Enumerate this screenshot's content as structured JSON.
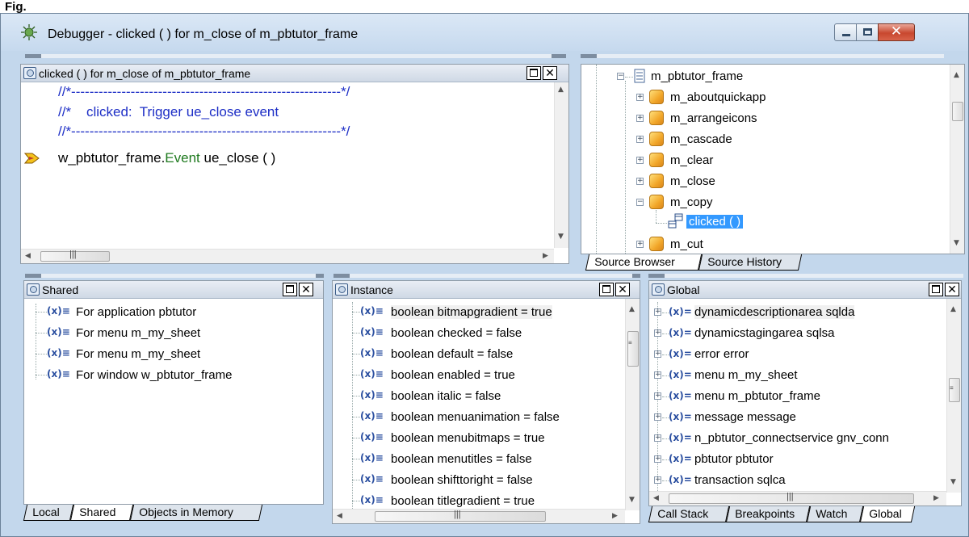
{
  "page_label": "Fig.",
  "window": {
    "title": "Debugger - clicked ( ) for m_close of m_pbtutor_frame",
    "title_icon": "bug-icon"
  },
  "source_pane": {
    "title": "clicked ( ) for m_close of m_pbtutor_frame",
    "lines": [
      "//*-----------------------------------------------------------*/",
      "//*    clicked:  Trigger ue_close event",
      "//*-----------------------------------------------------------*/"
    ],
    "current_line": {
      "object": "w_pbtutor_frame.",
      "keyword": "Event",
      "rest": " ue_close ( )"
    }
  },
  "browser_pane": {
    "root": "m_pbtutor_frame",
    "items": [
      "m_aboutquickapp",
      "m_arrangeicons",
      "m_cascade",
      "m_clear",
      "m_close",
      "m_copy",
      "clicked ( )",
      "m_cut"
    ],
    "tabs": [
      "Source Browser",
      "Source History"
    ]
  },
  "shared_pane": {
    "title": "Shared",
    "items": [
      "For application pbtutor",
      "For menu m_my_sheet",
      "For menu m_my_sheet",
      "For window w_pbtutor_frame"
    ],
    "tabs": [
      "Local",
      "Shared",
      "Objects in Memory"
    ]
  },
  "instance_pane": {
    "title": "Instance",
    "items": [
      "boolean bitmapgradient = true",
      "boolean checked = false",
      "boolean default = false",
      "boolean enabled = true",
      "boolean italic = false",
      "boolean menuanimation = false",
      "boolean menubitmaps = true",
      "boolean menutitles = false",
      "boolean shifttoright = false",
      "boolean titlegradient = true"
    ]
  },
  "global_pane": {
    "title": "Global",
    "items": [
      "dynamicdescriptionarea sqlda",
      "dynamicstagingarea sqlsa",
      "error error",
      "menu m_my_sheet",
      "menu m_pbtutor_frame",
      "message message",
      "n_pbtutor_connectservice gnv_conn",
      "pbtutor pbtutor",
      "transaction sqlca"
    ],
    "var_prefix": "(x)=",
    "tabs": [
      "Call Stack",
      "Breakpoints",
      "Watch",
      "Global"
    ]
  },
  "colors": {
    "frame": "#c3d7ec",
    "comment": "#1d2ec6",
    "keyword": "#1f7a1f",
    "selection": "#3399ff"
  }
}
